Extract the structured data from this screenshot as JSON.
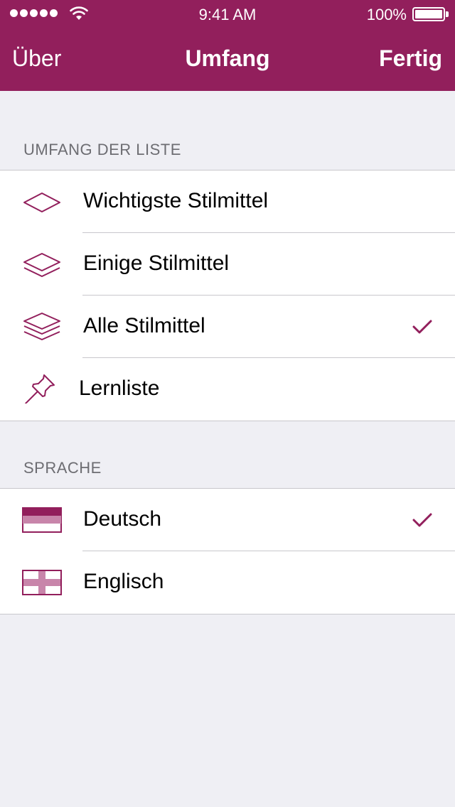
{
  "status_bar": {
    "time": "9:41 AM",
    "battery": "100%"
  },
  "nav": {
    "left": "Über",
    "title": "Umfang",
    "right": "Fertig"
  },
  "sections": {
    "scope": {
      "header": "UMFANG DER LISTE",
      "items": [
        {
          "label": "Wichtigste Stilmittel",
          "icon": "single-layer-icon",
          "checked": false
        },
        {
          "label": "Einige Stilmittel",
          "icon": "two-layers-icon",
          "checked": false
        },
        {
          "label": "Alle Stilmittel",
          "icon": "three-layers-icon",
          "checked": true
        },
        {
          "label": "Lernliste",
          "icon": "pin-icon",
          "checked": false
        }
      ]
    },
    "language": {
      "header": "SPRACHE",
      "items": [
        {
          "label": "Deutsch",
          "icon": "german-flag-icon",
          "checked": true
        },
        {
          "label": "Englisch",
          "icon": "english-flag-icon",
          "checked": false
        }
      ]
    }
  },
  "colors": {
    "accent": "#921f5c",
    "background": "#efeff4",
    "separator": "#c8c7cc",
    "section_text": "#6d6d72"
  }
}
